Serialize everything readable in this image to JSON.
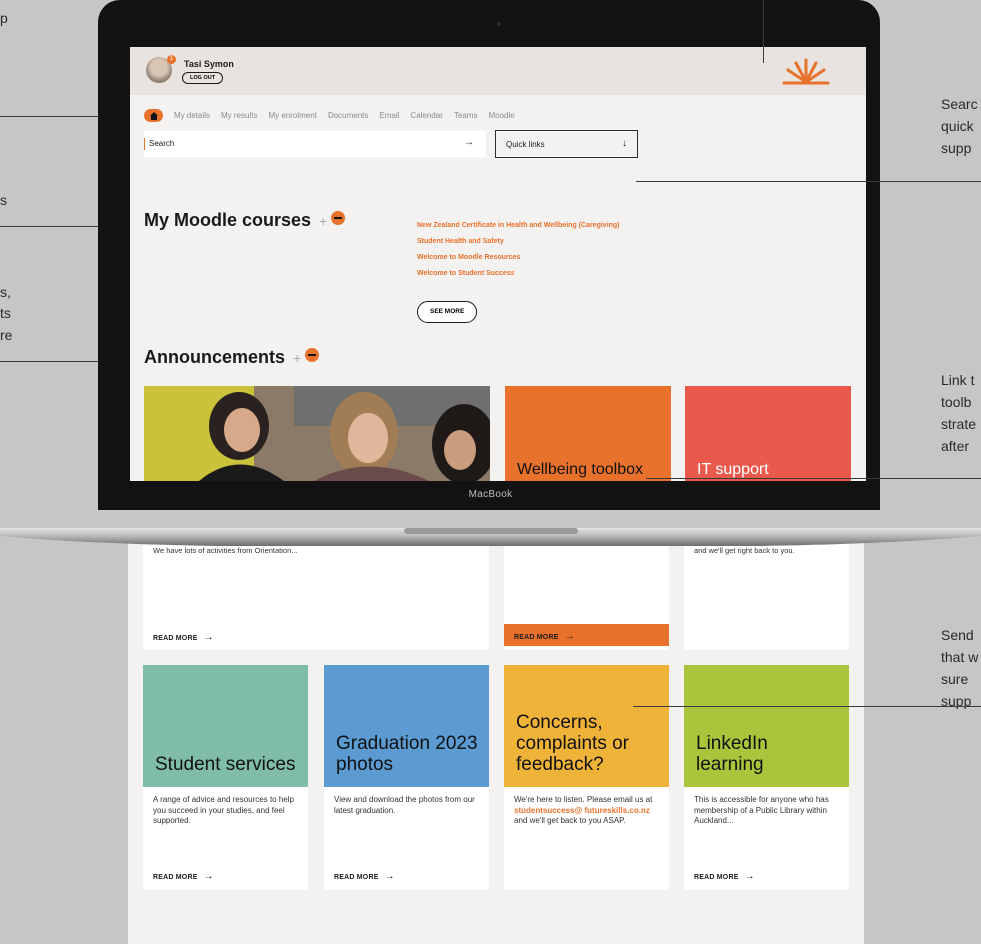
{
  "annotations": {
    "left": [
      "p",
      "s",
      "s,",
      "ts",
      "re"
    ],
    "right": [
      "Searc",
      "quick",
      "supp",
      "Link t",
      "toolb",
      "strate",
      "after",
      "Send",
      "that w",
      "sure",
      "supp"
    ]
  },
  "laptop": {
    "brand": "MacBook"
  },
  "user": {
    "name": "Tasi Symon",
    "badge": "1",
    "logout_label": "LOG OUT"
  },
  "nav": {
    "items": [
      "My details",
      "My results",
      "My enrolment",
      "Documents",
      "Email",
      "Calendar",
      "Teams",
      "Moodle"
    ]
  },
  "search": {
    "placeholder": "Search",
    "arrow": "→"
  },
  "quick_links": {
    "label": "Quick links",
    "arrow": "↓"
  },
  "moodle": {
    "title": "My Moodle courses",
    "plus": "+",
    "courses": [
      "New Zealand Certificate in Health and Wellbeing (Caregiving)",
      "Student Health and Safety",
      "Welcome to Moodle Resources",
      "Welcome to Student Success"
    ],
    "see_more_label": "SEE MORE"
  },
  "announcements": {
    "title": "Announcements",
    "plus": "+",
    "tiles": [
      "Wellbeing toolbox",
      "IT support"
    ]
  },
  "cards_row1": {
    "orientation_snippet": "We have lots of activities from Orientation...",
    "it_snippet": "and we'll get right back to you.",
    "read_more": "READ MORE"
  },
  "cards_row2": [
    {
      "title": "Student services",
      "body": "A range of advice and resources to help you succeed in your studies, and feel supported.",
      "read_more": "READ MORE",
      "arrow": "→",
      "color": "#7fbcaa"
    },
    {
      "title": "Graduation 2023 photos",
      "body": "View and download the photos from our latest graduation.",
      "read_more": "READ MORE",
      "arrow": "→",
      "color": "#5b9bd1"
    },
    {
      "title": "Concerns, complaints or feedback?",
      "body_pre": "We're here to listen. Please email us at ",
      "email": "studentsuccess@ futureskills.co.nz",
      "body_post": " and we'll get back to you ASAP.",
      "color": "#efb339"
    },
    {
      "title": "LinkedIn learning",
      "body": "This is accessible for anyone who has membership of a Public Library within Auckland...",
      "read_more": "READ MORE",
      "arrow": "→",
      "color": "#aac43b"
    }
  ],
  "colors": {
    "accent": "#e8712b",
    "it_red": "#e95a4d",
    "wellbeing_orange": "#e8712b"
  }
}
